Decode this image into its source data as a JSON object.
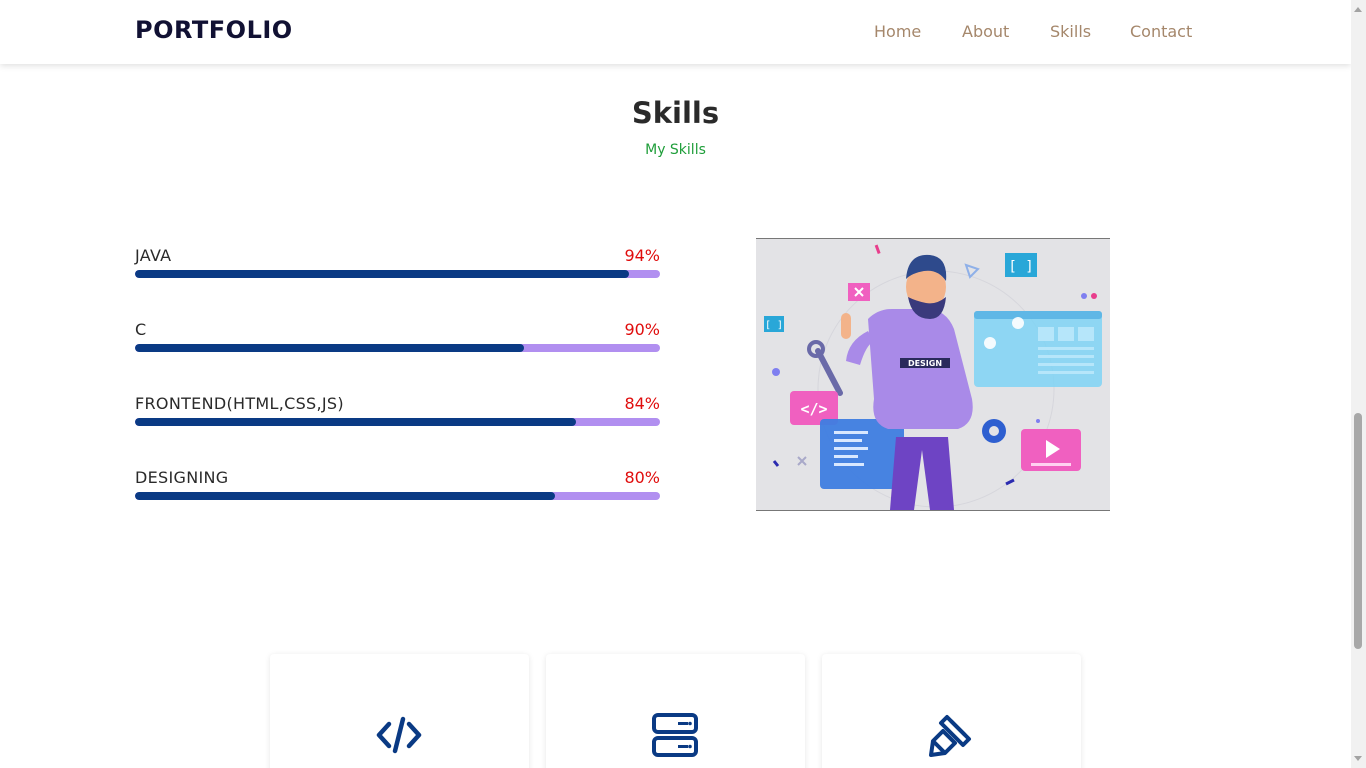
{
  "nav": {
    "logo": "PORTFOLIO",
    "links": [
      {
        "label": "Home"
      },
      {
        "label": "About"
      },
      {
        "label": "Skills"
      },
      {
        "label": "Contact"
      }
    ]
  },
  "section": {
    "title": "Skills",
    "subtitle": "My Skills"
  },
  "skills": [
    {
      "name": "JAVA",
      "percent_label": "94%",
      "fill_fraction": 0.94
    },
    {
      "name": "C",
      "percent_label": "90%",
      "fill_fraction": 0.74
    },
    {
      "name": "FRONTEND(HTML,CSS,JS)",
      "percent_label": "84%",
      "fill_fraction": 0.84
    },
    {
      "name": "DESIGNING",
      "percent_label": "80%",
      "fill_fraction": 0.8
    }
  ],
  "illustration": {
    "badge_text": "DESIGN",
    "icon_names": [
      "close-icon",
      "brackets-icon",
      "code-icon",
      "wrench-icon",
      "gear-icon",
      "play-icon",
      "browser-window-icon",
      "document-icon"
    ]
  },
  "services": [
    {
      "icon": "code-icon"
    },
    {
      "icon": "server-icon"
    },
    {
      "icon": "paint-brush-icon"
    }
  ],
  "colors": {
    "accent_fill": "#0a3a84",
    "track": "#b18ff0",
    "percent_text": "#e00d0d",
    "subtitle": "#1f9e3a",
    "nav_link": "#a5876b",
    "icon_blue": "#0a3a84"
  }
}
